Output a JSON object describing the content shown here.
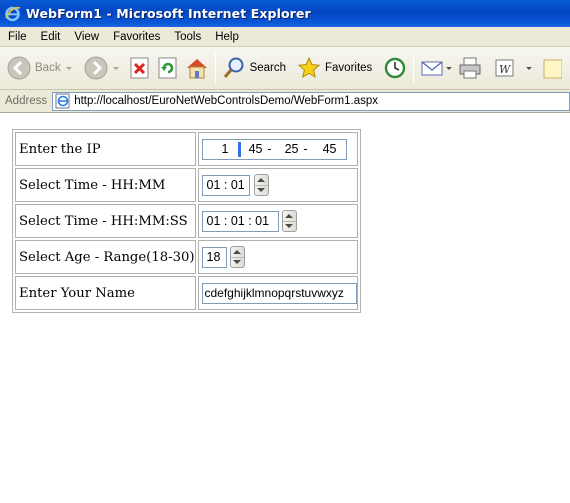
{
  "window": {
    "title": "WebForm1 - Microsoft Internet Explorer"
  },
  "menu": [
    "File",
    "Edit",
    "View",
    "Favorites",
    "Tools",
    "Help"
  ],
  "toolbar": {
    "back_label": "Back",
    "search_label": "Search",
    "favorites_label": "Favorites",
    "icons": [
      "back-icon",
      "forward-icon",
      "stop-icon",
      "refresh-icon",
      "home-icon",
      "search-icon",
      "favorites-star-icon",
      "history-icon",
      "mail-icon",
      "print-icon",
      "edit-word-icon",
      "discuss-icon"
    ]
  },
  "address": {
    "label": "Address",
    "url": "http://localhost/EuroNetWebControlsDemo/WebForm1.aspx"
  },
  "form": {
    "rows": [
      {
        "label": "Enter the IP"
      },
      {
        "label": "Select Time - HH:MM"
      },
      {
        "label": "Select Time - HH:MM:SS"
      },
      {
        "label": "Select Age - Range(18-30)"
      },
      {
        "label": "Enter Your Name"
      }
    ],
    "ip": {
      "octet1": "1",
      "octet2": "45",
      "octet3": "25",
      "octet4": "45",
      "separator": "-"
    },
    "time_hhmm": "01 : 01",
    "time_hhmmss": "01 :  01 : 01",
    "age": "18",
    "name": "cdefghijklmnopqrstuvwxyz"
  },
  "colors": {
    "titlebar": "#0a5bd8",
    "chrome": "#ece9d8",
    "input_border": "#7f9db9",
    "caret": "#3a6ee8"
  }
}
